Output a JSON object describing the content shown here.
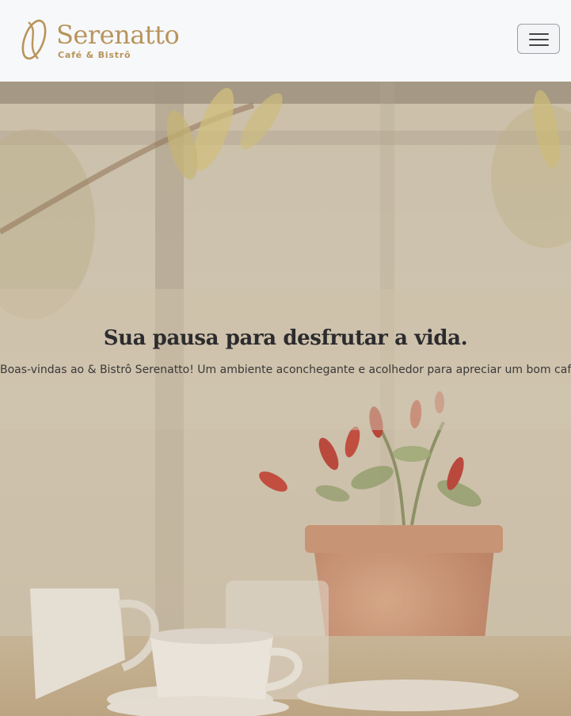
{
  "navbar": {
    "brand": "Serenatto",
    "tagline": "Café & Bistrô",
    "logo_icon": "coffee-bean-icon",
    "menu_icon": "hamburger-menu-icon"
  },
  "hero": {
    "title": "Sua pausa para desfrutar a vida.",
    "subtitle": "Boas-vindas ao & Bistrô Serenatto! Um ambiente aconchegante e acolhedor para apreciar um bom café."
  },
  "colors": {
    "brand": "#b8945b",
    "navbar_bg": "#f7f8fa",
    "title": "#2c2b2e"
  }
}
